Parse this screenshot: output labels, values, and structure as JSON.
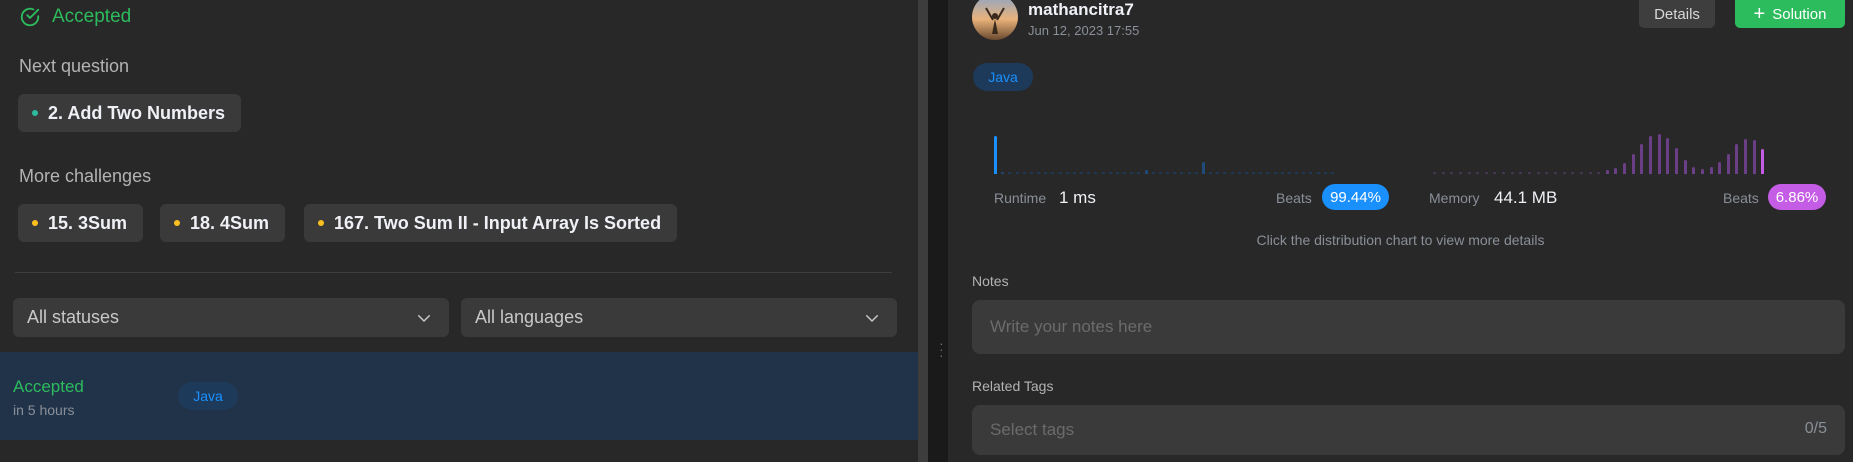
{
  "left": {
    "accepted_title": "Accepted",
    "next_question_label": "Next question",
    "next_question": "2. Add Two Numbers",
    "more_challenges_label": "More challenges",
    "challenges": [
      "15. 3Sum",
      "18. 4Sum",
      "167. Two Sum II - Input Array Is Sorted"
    ],
    "status_filter": "All statuses",
    "language_filter": "All languages",
    "submission": {
      "status": "Accepted",
      "time": "in 5 hours",
      "language": "Java"
    }
  },
  "right": {
    "user": {
      "name": "mathancitra7",
      "date": "Jun 12, 2023 17:55"
    },
    "details_button": "Details",
    "solution_button": "Solution",
    "language": "Java",
    "runtime": {
      "label": "Runtime",
      "value": "1 ms",
      "beats_label": "Beats",
      "beats": "99.44%"
    },
    "memory": {
      "label": "Memory",
      "value": "44.1 MB",
      "beats_label": "Beats",
      "beats": "6.86%"
    },
    "hint": "Click the distribution chart to view more details",
    "notes_label": "Notes",
    "notes_placeholder": "Write your notes here",
    "tags_label": "Related Tags",
    "tags_placeholder": "Select tags",
    "tags_count": "0/5"
  },
  "colors": {
    "accepted": "#2cbb5d",
    "runtime_accent": "#1a90ff",
    "memory_accent": "#c55ce6",
    "selected_row": "#213349",
    "panel_bg": "#282828",
    "dot_green": "#2cbb9e",
    "dot_yellow": "#ffc01e"
  },
  "icons": {
    "accepted": "check-circle-icon",
    "dropdown": "chevron-down-icon",
    "add": "plus-icon"
  },
  "chart_data": [
    {
      "type": "bar",
      "name": "runtime-distribution",
      "values": [
        62,
        4,
        3,
        3,
        3,
        3,
        3,
        3,
        3,
        3,
        3,
        3,
        3,
        3,
        3,
        3,
        3,
        3,
        3,
        3,
        3,
        7,
        3,
        3,
        3,
        3,
        3,
        3,
        3,
        19,
        3,
        3,
        3,
        3,
        3,
        3,
        3,
        3,
        3,
        3,
        3,
        3,
        3,
        3,
        3,
        3,
        3,
        3
      ],
      "highlight_index": 0,
      "ylim": [
        0,
        100
      ]
    },
    {
      "type": "bar",
      "name": "memory-distribution",
      "values": [
        3,
        3,
        3,
        3,
        3,
        3,
        3,
        3,
        3,
        3,
        3,
        3,
        3,
        3,
        3,
        3,
        3,
        3,
        3,
        3,
        6,
        10,
        17,
        32,
        48,
        61,
        64,
        58,
        42,
        23,
        12,
        8,
        12,
        20,
        33,
        48,
        56,
        55,
        41
      ],
      "highlight_index": 38,
      "ylim": [
        0,
        100
      ]
    }
  ]
}
